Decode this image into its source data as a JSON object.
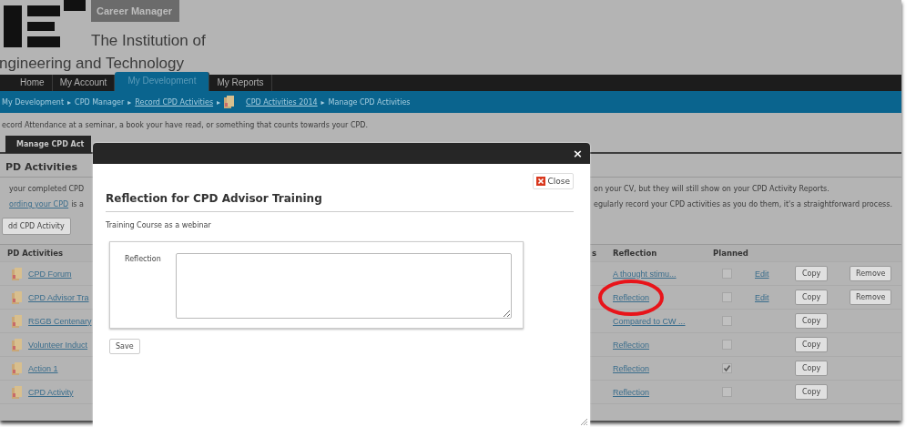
{
  "header": {
    "badge": "Career Manager",
    "org_line_1": "The Institution of",
    "org_line_2": "ngineering and Technology"
  },
  "nav_tabs": [
    {
      "label": "Home",
      "selected": false
    },
    {
      "label": "My Account",
      "selected": false
    },
    {
      "label": "My Development",
      "selected": true
    },
    {
      "label": "My Reports",
      "selected": false
    }
  ],
  "breadcrumb": [
    {
      "label": "My Development",
      "kind": "text"
    },
    {
      "separator": "▸",
      "label": "CPD Manager",
      "kind": "text"
    },
    {
      "separator": "▸",
      "label": "Record CPD Activities",
      "kind": "link"
    },
    {
      "separator": "▸",
      "label": "CPD Activities 2014",
      "kind": "folder_link"
    },
    {
      "separator": "▸",
      "label": "Manage CPD Activities",
      "kind": "text"
    }
  ],
  "intro": "ecord Attendance at a seminar, a book your have read, or something that counts towards your CPD.",
  "sub_tab": "Manage CPD Act",
  "section_title": "PD Activities",
  "info_lines": [
    {
      "left": "your completed CPD",
      "right": "on your CV, but they will still show on your CPD Activity Reports."
    },
    {
      "link": "ording your CPD",
      "left": "is a",
      "right": "egularly record your CPD activities as you do them, it's a straightforward process."
    }
  ],
  "add_button": "dd CPD Activity",
  "table": {
    "columns": [
      "PD Activities",
      "s",
      "Reflection",
      "Planned"
    ],
    "rows": [
      {
        "name": "CPD Forum",
        "reflection": "A thought stimu...",
        "planned": false,
        "highlighted": false,
        "edit": "Edit",
        "copy": "Copy",
        "remove": "Remove"
      },
      {
        "name": "CPD Advisor Tra",
        "reflection": "Reflection",
        "planned": false,
        "highlighted": true,
        "edit": "Edit",
        "copy": "Copy",
        "remove": "Remove"
      },
      {
        "name": "RSGB Centenary",
        "reflection": "Compared to CW ...",
        "planned": false,
        "highlighted": false,
        "copy": "Copy"
      },
      {
        "name": "Volunteer Induct",
        "reflection": "Reflection",
        "planned": false,
        "highlighted": false,
        "copy": "Copy"
      },
      {
        "name": "Action 1",
        "reflection": "Reflection",
        "planned": true,
        "highlighted": false,
        "copy": "Copy"
      },
      {
        "name": "CPD Activity",
        "reflection": "Reflection",
        "planned": false,
        "highlighted": false,
        "copy": "Copy"
      }
    ]
  },
  "modal": {
    "close_icon": "×",
    "close_button": "Close",
    "title": "Reflection for CPD Advisor Training",
    "subtitle": "Training Course as a webinar",
    "field_label": "Reflection",
    "save_button": "Save"
  }
}
